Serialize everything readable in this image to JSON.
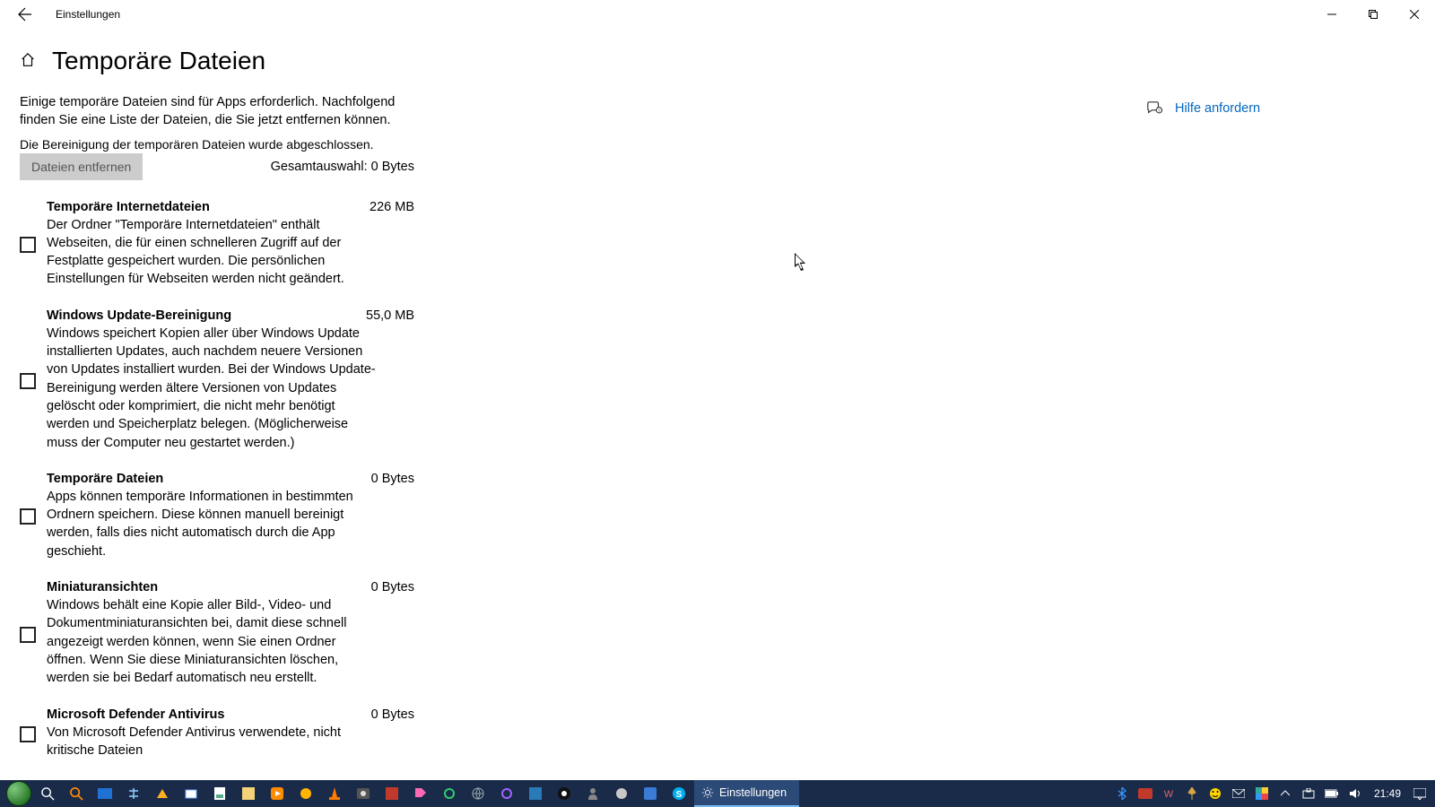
{
  "window": {
    "app_title": "Einstellungen",
    "page_title": "Temporäre Dateien"
  },
  "intro": "Einige temporäre Dateien sind für Apps erforderlich. Nachfolgend finden Sie eine Liste der Dateien, die Sie jetzt entfernen können.",
  "status": "Die Bereinigung der temporären Dateien wurde abgeschlossen.",
  "remove_button": "Dateien entfernen",
  "total_label": "Gesamtauswahl: 0 Bytes",
  "items": [
    {
      "title": "Temporäre Internetdateien",
      "size": "226 MB",
      "desc": "Der Ordner \"Temporäre Internetdateien\" enthält Webseiten, die für einen schnelleren Zugriff auf der Festplatte gespeichert wurden. Die persönlichen Einstellungen für Webseiten werden nicht geändert."
    },
    {
      "title": "Windows Update-Bereinigung",
      "size": "55,0 MB",
      "desc": "Windows speichert Kopien aller über Windows Update installierten Updates, auch nachdem neuere Versionen von Updates installiert wurden. Bei der Windows Update-Bereinigung werden ältere Versionen von Updates gelöscht oder komprimiert, die nicht mehr benötigt werden und Speicherplatz belegen. (Möglicherweise muss der Computer neu gestartet werden.)"
    },
    {
      "title": "Temporäre Dateien",
      "size": "0 Bytes",
      "desc": "Apps können temporäre Informationen in bestimmten Ordnern speichern. Diese können manuell bereinigt werden, falls dies nicht automatisch durch die App geschieht."
    },
    {
      "title": "Miniaturansichten",
      "size": "0 Bytes",
      "desc": "Windows behält eine Kopie aller Bild-, Video- und Dokumentminiaturansichten bei, damit diese schnell angezeigt werden können, wenn Sie einen Ordner öffnen. Wenn Sie diese Miniaturansichten löschen, werden sie bei Bedarf automatisch neu erstellt."
    },
    {
      "title": "Microsoft Defender Antivirus",
      "size": "0 Bytes",
      "desc": "Von Microsoft Defender Antivirus verwendete, nicht kritische Dateien"
    }
  ],
  "help_link": "Hilfe anfordern",
  "taskbar": {
    "active_app": "Einstellungen",
    "clock": "21:49"
  }
}
